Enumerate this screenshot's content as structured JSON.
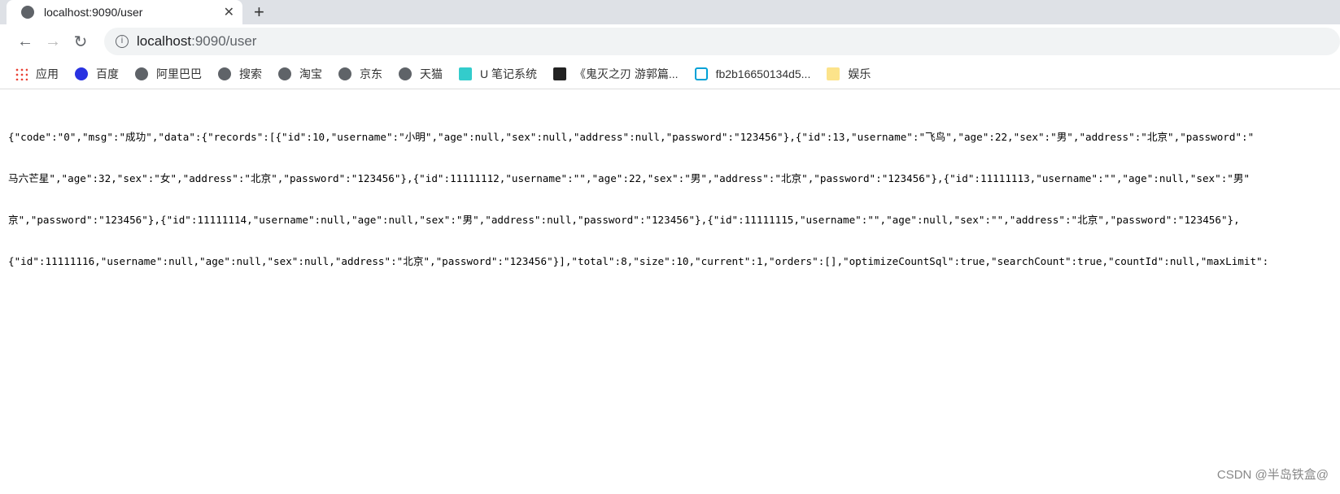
{
  "tab": {
    "title": "localhost:9090/user"
  },
  "address": {
    "host": "localhost",
    "path": ":9090/user"
  },
  "bookmarks": [
    {
      "label": "应用",
      "icon": "apps-icon"
    },
    {
      "label": "百度",
      "icon": "baidu-icon"
    },
    {
      "label": "阿里巴巴",
      "icon": "globe-icon"
    },
    {
      "label": "搜索",
      "icon": "globe-icon"
    },
    {
      "label": "淘宝",
      "icon": "globe-icon"
    },
    {
      "label": "京东",
      "icon": "globe-icon"
    },
    {
      "label": "天猫",
      "icon": "globe-icon"
    },
    {
      "label": "U 笔记系统",
      "icon": "note-icon"
    },
    {
      "label": "《鬼灭之刃 游郭篇...",
      "icon": "game-icon"
    },
    {
      "label": "fb2b16650134d5...",
      "icon": "bilibili-icon"
    },
    {
      "label": "娱乐",
      "icon": "folder-icon"
    }
  ],
  "body_lines": [
    "{\"code\":\"0\",\"msg\":\"成功\",\"data\":{\"records\":[{\"id\":10,\"username\":\"小明\",\"age\":null,\"sex\":null,\"address\":null,\"password\":\"123456\"},{\"id\":13,\"username\":\"飞鸟\",\"age\":22,\"sex\":\"男\",\"address\":\"北京\",\"password\":\"",
    "马六芒星\",\"age\":32,\"sex\":\"女\",\"address\":\"北京\",\"password\":\"123456\"},{\"id\":11111112,\"username\":\"\",\"age\":22,\"sex\":\"男\",\"address\":\"北京\",\"password\":\"123456\"},{\"id\":11111113,\"username\":\"\",\"age\":null,\"sex\":\"男\"",
    "京\",\"password\":\"123456\"},{\"id\":11111114,\"username\":null,\"age\":null,\"sex\":\"男\",\"address\":null,\"password\":\"123456\"},{\"id\":11111115,\"username\":\"\",\"age\":null,\"sex\":\"\",\"address\":\"北京\",\"password\":\"123456\"},",
    "{\"id\":11111116,\"username\":null,\"age\":null,\"sex\":null,\"address\":\"北京\",\"password\":\"123456\"}],\"total\":8,\"size\":10,\"current\":1,\"orders\":[],\"optimizeCountSql\":true,\"searchCount\":true,\"countId\":null,\"maxLimit\":"
  ],
  "watermark": "CSDN @半岛铁盒@"
}
